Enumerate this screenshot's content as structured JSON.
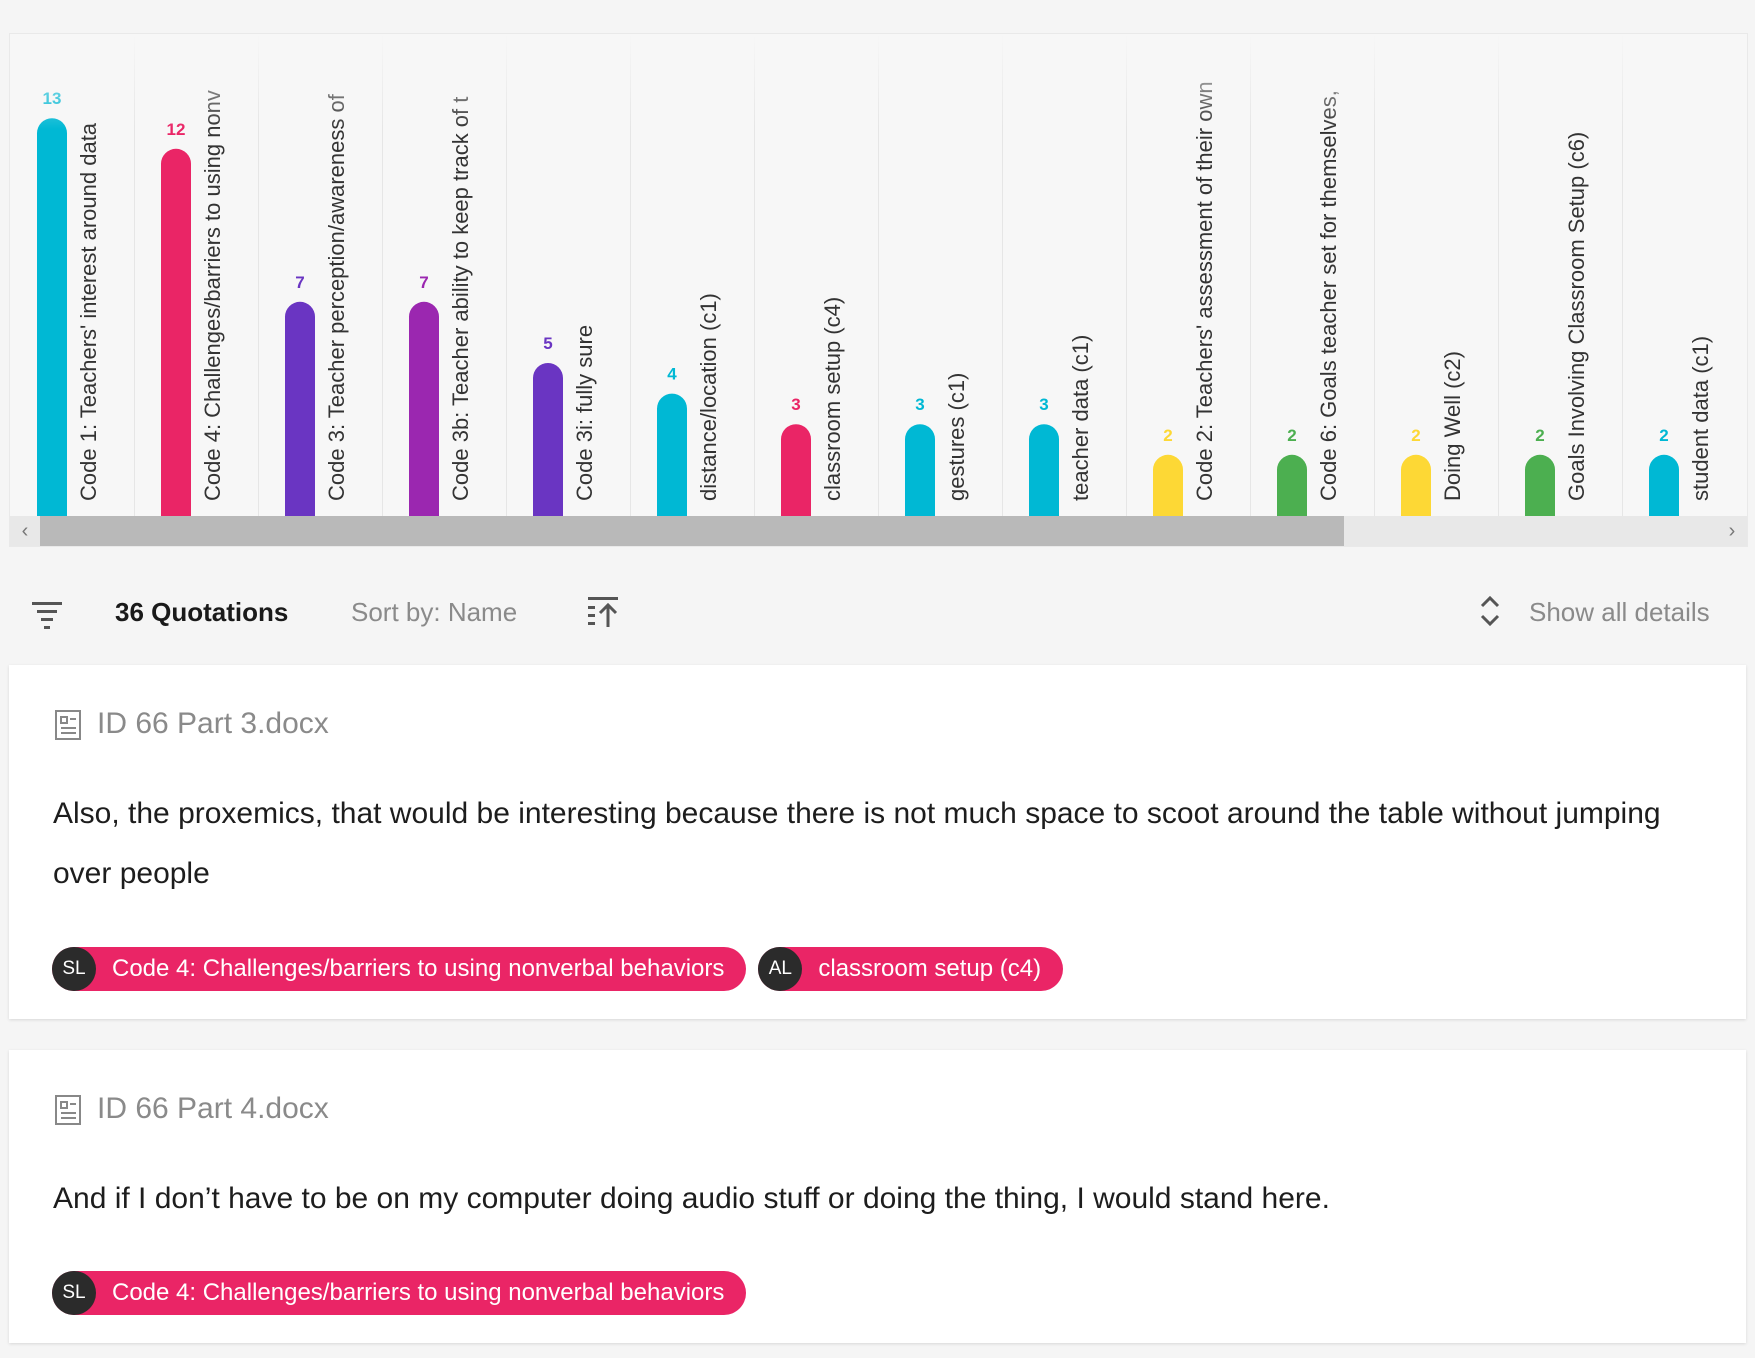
{
  "chart_data": {
    "type": "bar",
    "categories": [
      "Code 1: Teachers' interest around data",
      "Code 4: Challenges/barriers to using nonv",
      "Code 3: Teacher perception/awareness of",
      "Code 3b: Teacher ability to keep track of t",
      "Code 3i: fully sure",
      "distance/location (c1)",
      "classroom setup (c4)",
      "gestures (c1)",
      "teacher data (c1)",
      "Code 2: Teachers' assessment of their own",
      "Code 6: Goals teacher set for themselves,",
      "Doing Well (c2)",
      "Goals Involving Classroom Setup (c6)",
      "student data (c1)"
    ],
    "values": [
      13,
      12,
      7,
      7,
      5,
      4,
      3,
      3,
      3,
      2,
      2,
      2,
      2,
      2
    ],
    "colors": [
      "#00b8d4",
      "#ea2566",
      "#6a35c2",
      "#9b27b0",
      "#6a35c2",
      "#00b8d4",
      "#ea2566",
      "#00b8d4",
      "#00b8d4",
      "#fdd835",
      "#4caf50",
      "#fdd835",
      "#4caf50",
      "#00b8d4"
    ],
    "ylim": [
      0,
      13
    ],
    "grid": false,
    "title": "",
    "xlabel": "",
    "ylabel": ""
  },
  "scrollbar": {
    "left_arrow": "‹",
    "right_arrow": "›"
  },
  "toolbar": {
    "filter_icon": "filter-icon",
    "quotation_count": "36 Quotations",
    "sort_label": "Sort by: Name",
    "sort_direction_icon": "sort-ascending-icon",
    "expand_icon": "expand-collapse-icon",
    "show_all_details": "Show all details"
  },
  "quotations": [
    {
      "document": "ID 66 Part 3.docx",
      "text": "Also, the proxemics, that would be interesting because there is not much space to scoot around the table without jumping over people",
      "codes": [
        {
          "initials": "SL",
          "label": "Code 4: Challenges/barriers to using nonverbal behaviors"
        },
        {
          "initials": "AL",
          "label": "classroom setup (c4)"
        }
      ]
    },
    {
      "document": "ID 66 Part 4.docx",
      "text": "And if I don’t have to be on my computer doing audio stuff or doing the thing, I would stand here.",
      "codes": [
        {
          "initials": "SL",
          "label": "Code 4: Challenges/barriers to using nonverbal behaviors"
        }
      ]
    }
  ],
  "colors": {
    "chip_background": "#ea2566",
    "avatar_background": "#2b2b2b"
  }
}
